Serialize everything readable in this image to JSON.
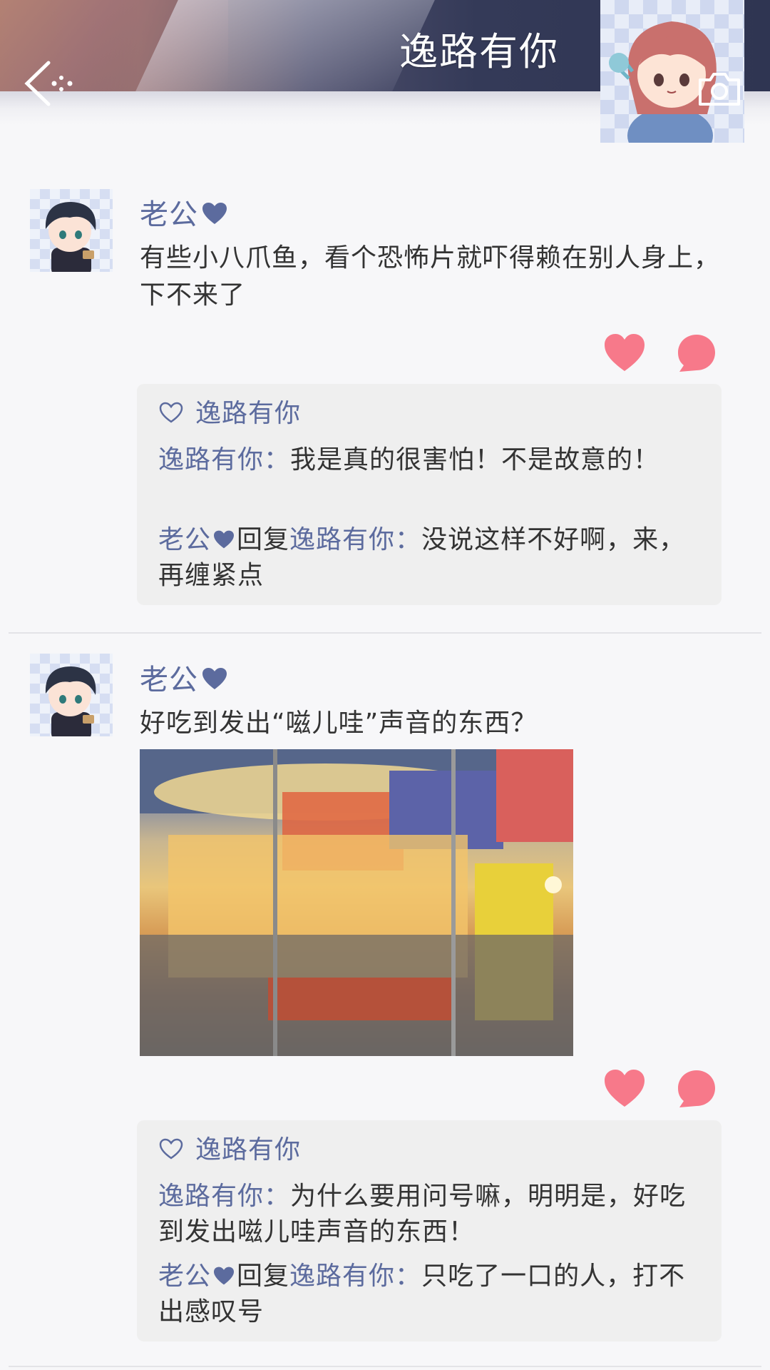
{
  "header": {
    "title": "逸路有你",
    "back_icon": "back-chevron-icon",
    "camera_icon": "camera-icon"
  },
  "colors": {
    "name_accent": "#5c6b9e",
    "like_pink": "#f7798a",
    "comment_bg": "#efefef"
  },
  "posts": [
    {
      "author": "老公",
      "text": "有些小八爪鱼，看个恐怖片就吓得赖在别人身上，下不来了",
      "liked_by": "逸路有你",
      "comments": [
        {
          "name": "逸路有你",
          "sep": "：",
          "text": "我是真的很害怕！不是故意的！"
        },
        {
          "name": "老公",
          "reply_word": "回复",
          "reply_to": "逸路有你",
          "sep": "：",
          "text": "没说这样不好啊，来，再缠紧点"
        }
      ]
    },
    {
      "author": "老公",
      "text": "好吃到发出“嗞儿哇”声音的东西？",
      "image_icon": "night-food-stalls-photo",
      "liked_by": "逸路有你",
      "comments": [
        {
          "name": "逸路有你",
          "sep": "：",
          "text": "为什么要用问号嘛，明明是，好吃到发出嗞儿哇声音的东西！"
        },
        {
          "name": "老公",
          "reply_word": "回复",
          "reply_to": "逸路有你",
          "sep": "：",
          "text": "只吃了一口的人，打不出感叹号"
        }
      ]
    }
  ]
}
